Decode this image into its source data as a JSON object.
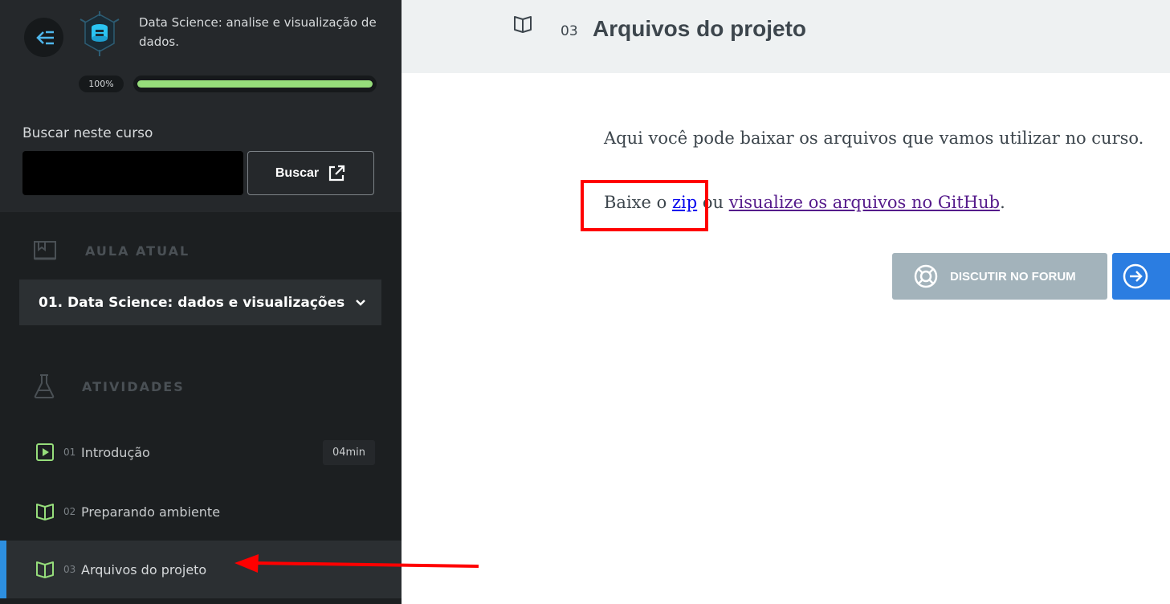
{
  "sidebar": {
    "course_title": "Data Science: analise e visualização de dados.",
    "progress": {
      "label": "100%",
      "fraction": 1.0
    },
    "search": {
      "label": "Buscar neste curso",
      "value": "",
      "button_label": "Buscar"
    },
    "current_lesson_heading": "AULA ATUAL",
    "current_lesson": "01. Data Science: dados e visualizações",
    "activities_heading": "ATIVIDADES",
    "activities": [
      {
        "num": "01",
        "name": "Introdução",
        "duration": "04min",
        "icon": "video-icon"
      },
      {
        "num": "02",
        "name": "Preparando ambiente",
        "duration": "",
        "icon": "book-icon"
      },
      {
        "num": "03",
        "name": "Arquivos do projeto",
        "duration": "",
        "icon": "book-icon",
        "active": true
      }
    ]
  },
  "header": {
    "num": "03",
    "title": "Arquivos do projeto"
  },
  "content": {
    "p1": "Aqui você pode baixar os arquivos que vamos utilizar no curso.",
    "p2_prefix": "Baixe o ",
    "zip_link": "zip",
    "p2_middle": " ou ",
    "github_link": "visualize os arquivos no GitHub",
    "p2_suffix": "."
  },
  "actions": {
    "forum_label": "DISCUTIR NO FORUM"
  },
  "colors": {
    "accent_green": "#96dd7b",
    "accent_blue": "#2b7de1",
    "annotation_red": "#ff0000",
    "sidebar_bg": "#1c1f21"
  }
}
